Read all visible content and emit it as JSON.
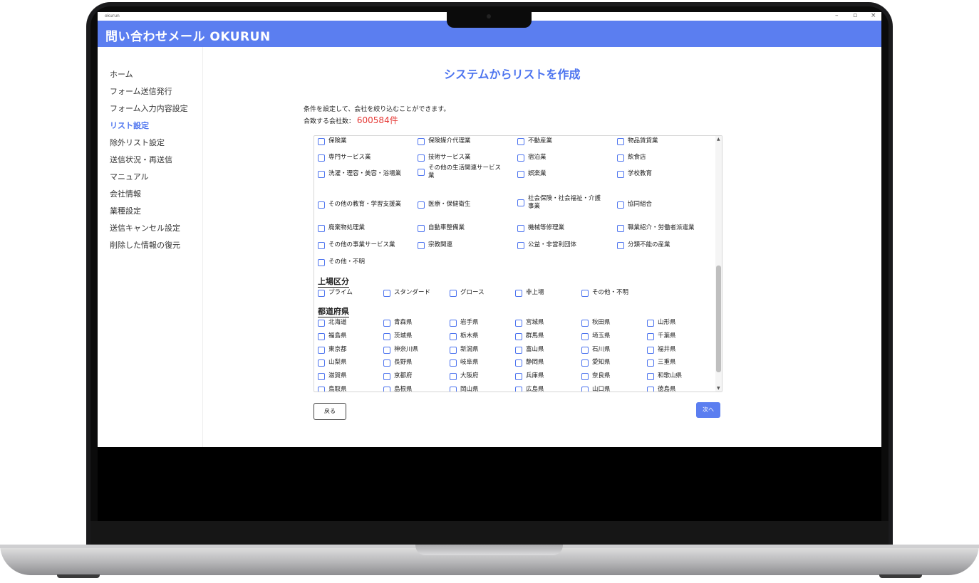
{
  "window": {
    "title": "okurun"
  },
  "app": {
    "title": "問い合わせメール OKURUN"
  },
  "sidebar": {
    "items": [
      {
        "label": "ホーム",
        "active": false
      },
      {
        "label": "フォーム送信発行",
        "active": false
      },
      {
        "label": "フォーム入力内容設定",
        "active": false
      },
      {
        "label": "リスト設定",
        "active": true
      },
      {
        "label": "除外リスト設定",
        "active": false
      },
      {
        "label": "送信状況・再送信",
        "active": false
      },
      {
        "label": "マニュアル",
        "active": false
      },
      {
        "label": "会社情報",
        "active": false
      },
      {
        "label": "業種設定",
        "active": false
      },
      {
        "label": "送信キャンセル設定",
        "active": false
      },
      {
        "label": "削除した情報の復元",
        "active": false
      }
    ]
  },
  "main": {
    "title": "システムからリストを作成",
    "description": "条件を設定して、会社を絞り込むことができます。",
    "count_label": "合致する会社数：",
    "count_value": "600584件"
  },
  "industries": [
    [
      "保険業",
      "保険媒介代理業",
      "不動産業",
      "物品賃貸業"
    ],
    [
      "専門サービス業",
      "技術サービス業",
      "宿泊業",
      "飲食店"
    ],
    [
      "洗濯・理容・美容・浴場業",
      "その他の生活関連サービス業",
      "娯楽業",
      "学校教育"
    ],
    [
      "その他の教育・学習支援業",
      "医療・保健衛生",
      "社会保険・社会福祉・介護事業",
      "協同組合"
    ],
    [
      "廃棄物処理業",
      "自動車整備業",
      "機械等修理業",
      "職業紹介・労働者派遣業"
    ],
    [
      "その他の事業サービス業",
      "宗教関連",
      "公益・非営利団体",
      "分類不能の産業"
    ],
    [
      "その他・不明"
    ]
  ],
  "listing": {
    "heading": "上場区分",
    "options": [
      "プライム",
      "スタンダード",
      "グロース",
      "非上場",
      "その他・不明"
    ]
  },
  "prefecture": {
    "heading": "都道府県",
    "rows": [
      [
        "北海道",
        "青森県",
        "岩手県",
        "宮城県",
        "秋田県",
        "山形県"
      ],
      [
        "福島県",
        "茨城県",
        "栃木県",
        "群馬県",
        "埼玉県",
        "千葉県"
      ],
      [
        "東京都",
        "神奈川県",
        "新潟県",
        "富山県",
        "石川県",
        "福井県"
      ],
      [
        "山梨県",
        "長野県",
        "岐阜県",
        "静岡県",
        "愛知県",
        "三重県"
      ],
      [
        "滋賀県",
        "京都府",
        "大阪府",
        "兵庫県",
        "奈良県",
        "和歌山県"
      ],
      [
        "鳥取県",
        "島根県",
        "岡山県",
        "広島県",
        "山口県",
        "徳島県"
      ]
    ]
  },
  "buttons": {
    "back": "戻る",
    "next": "次へ"
  },
  "colors": {
    "accent": "#5b7ef0",
    "count": "#e53935"
  }
}
